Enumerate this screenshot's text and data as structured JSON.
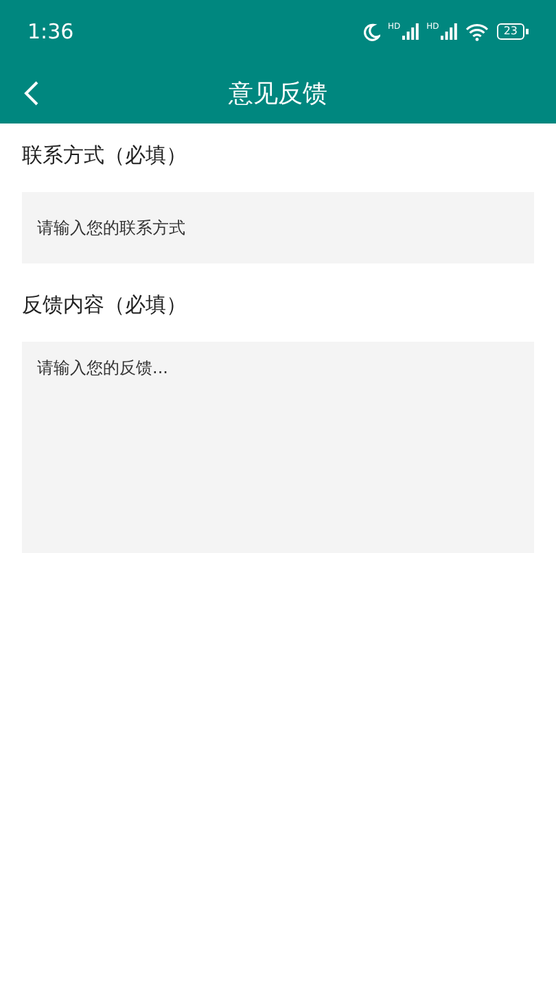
{
  "status_bar": {
    "time": "1:36",
    "signals": [
      {
        "badge": "HD"
      },
      {
        "badge": "HD"
      }
    ],
    "battery": "23"
  },
  "header": {
    "title": "意见反馈"
  },
  "fields": [
    {
      "kind": "input",
      "label": "联系方式（必填）",
      "placeholder": "请输入您的联系方式"
    },
    {
      "kind": "textarea",
      "label": "反馈内容（必填）",
      "placeholder": "请输入您的反馈..."
    }
  ]
}
